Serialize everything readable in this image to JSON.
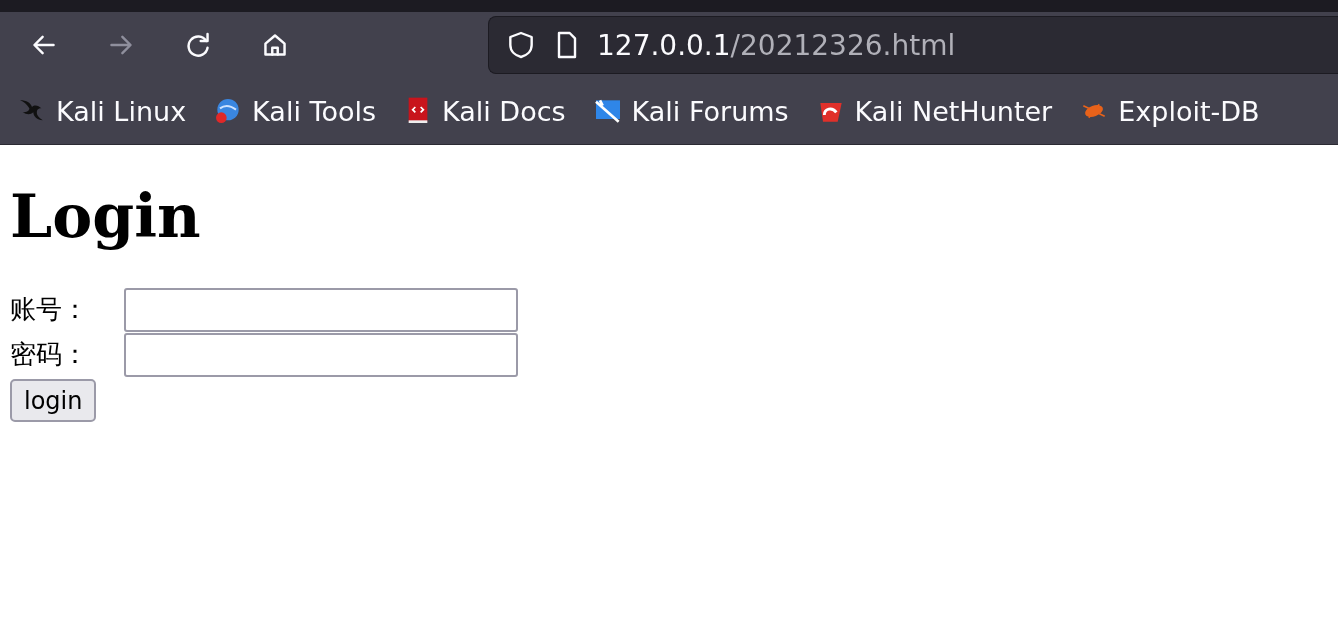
{
  "browser": {
    "nav_buttons": [
      {
        "kind": "back",
        "disabled": false
      },
      {
        "kind": "forward",
        "disabled": true
      },
      {
        "kind": "reload",
        "disabled": false
      },
      {
        "kind": "home",
        "disabled": false
      }
    ],
    "address_bar": {
      "host": "127.0.0.1",
      "path": "/20212326.html"
    },
    "bookmarks": [
      {
        "label": "Kali Linux"
      },
      {
        "label": "Kali Tools"
      },
      {
        "label": "Kali Docs"
      },
      {
        "label": "Kali Forums"
      },
      {
        "label": "Kali NetHunter"
      },
      {
        "label": "Exploit-DB"
      }
    ]
  },
  "page": {
    "title": "Login",
    "fields": [
      {
        "label": "账号："
      },
      {
        "label": "密码："
      }
    ],
    "button": "login"
  }
}
